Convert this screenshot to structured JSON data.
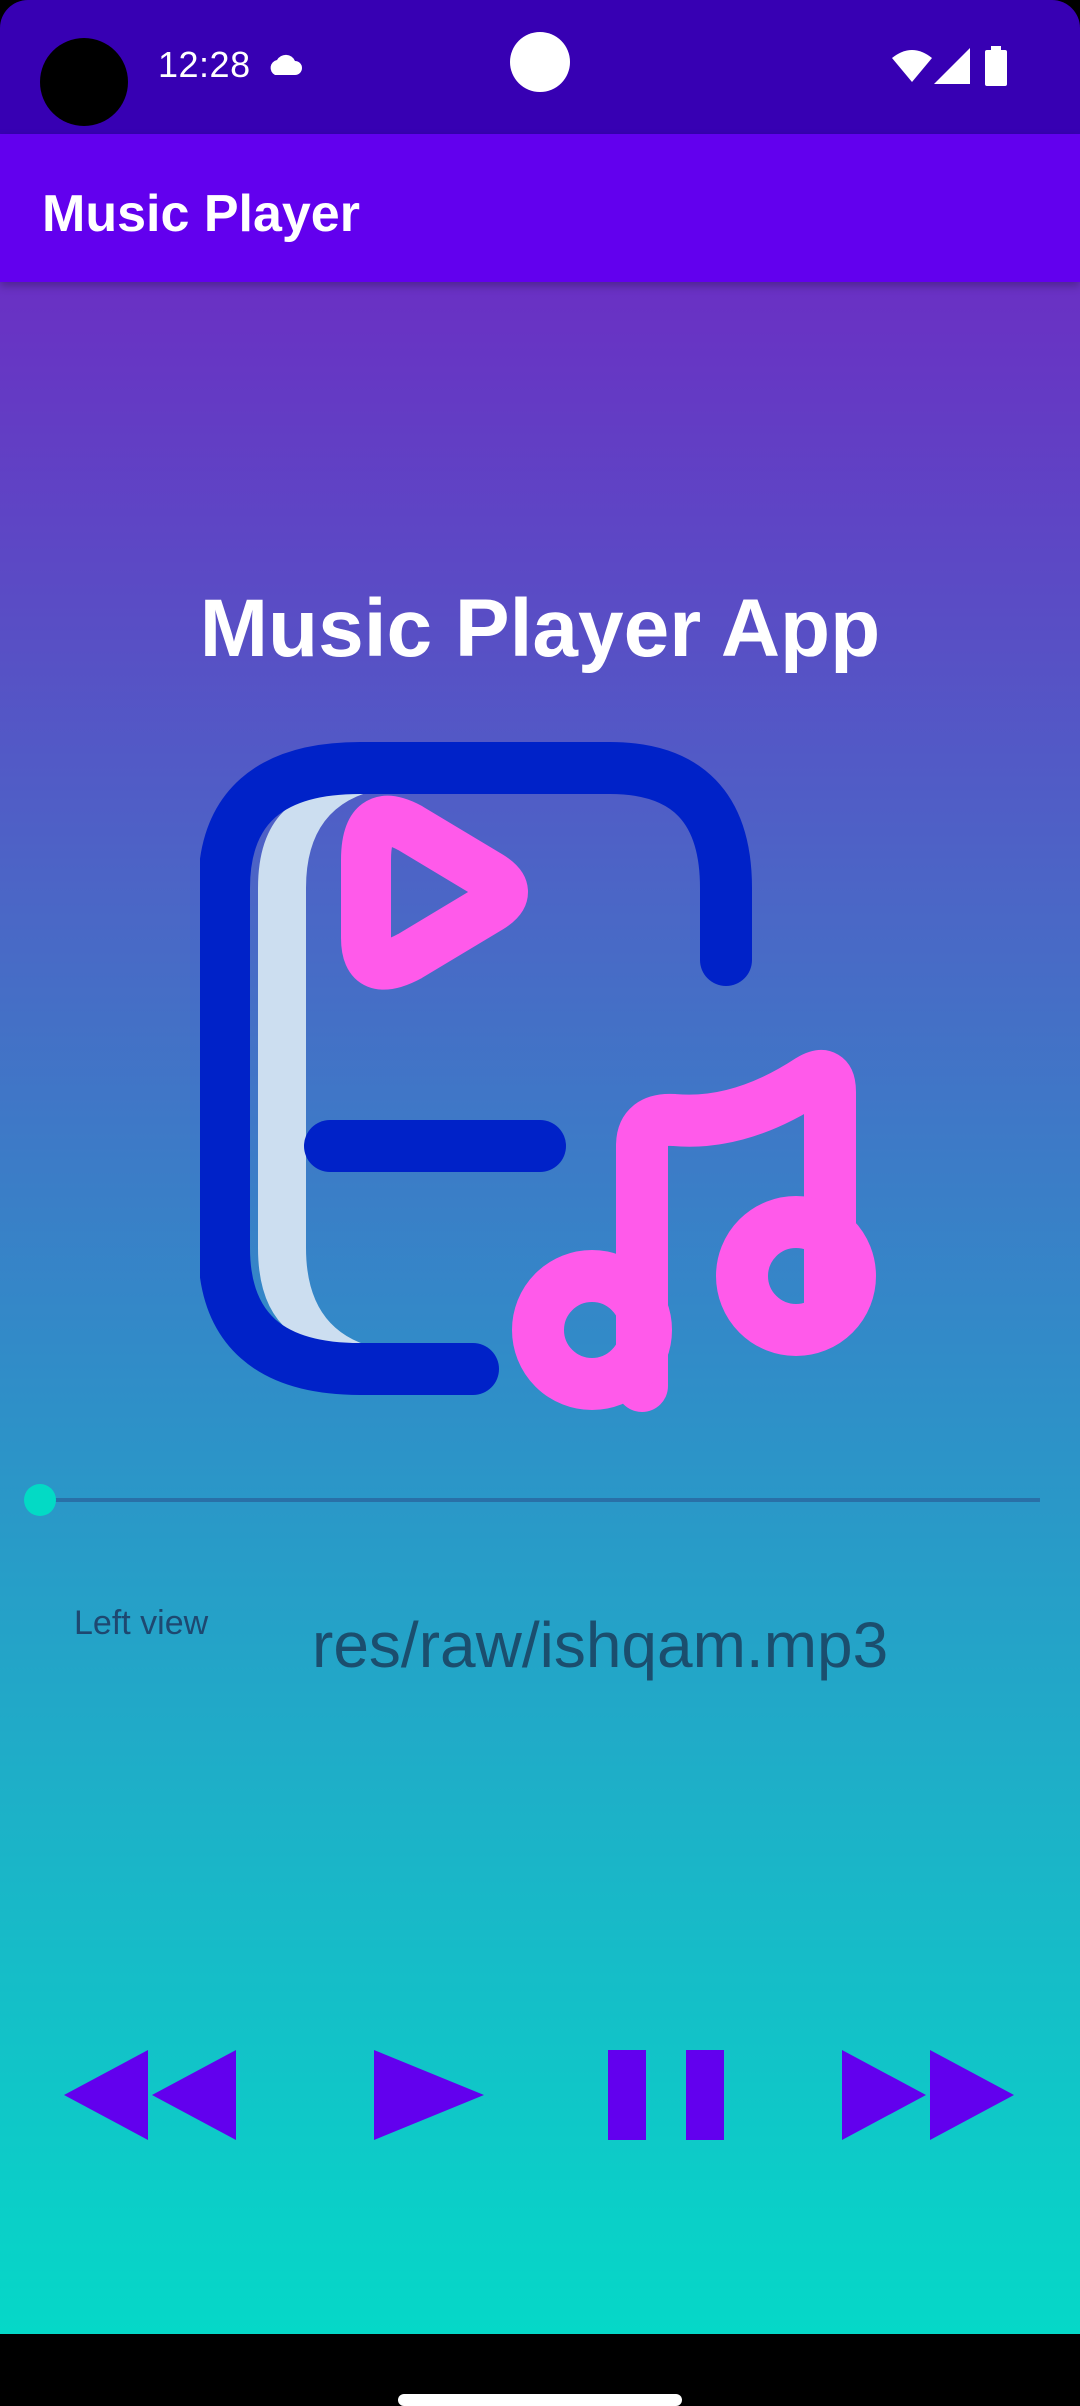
{
  "status_bar": {
    "time": "12:28",
    "icons": [
      "cloud-icon",
      "wifi-icon",
      "signal-icon",
      "battery-icon"
    ]
  },
  "app_bar": {
    "title": "Music Player",
    "background": "#6200EE"
  },
  "main": {
    "heading": "Music Player App",
    "logo": "music-player-logo",
    "seek": {
      "progress": 0.0
    },
    "left_view_label": "Left view",
    "file_path": "res/raw/ishqam.mp3"
  },
  "controls": [
    {
      "name": "rewind-button",
      "icon": "rewind-icon"
    },
    {
      "name": "play-button",
      "icon": "play-icon"
    },
    {
      "name": "pause-button",
      "icon": "pause-icon"
    },
    {
      "name": "fast-forward-button",
      "icon": "fast-forward-icon"
    }
  ],
  "colors": {
    "accent": "#03DAC5",
    "control": "#6200EE",
    "status_bar": "#3700B3"
  }
}
